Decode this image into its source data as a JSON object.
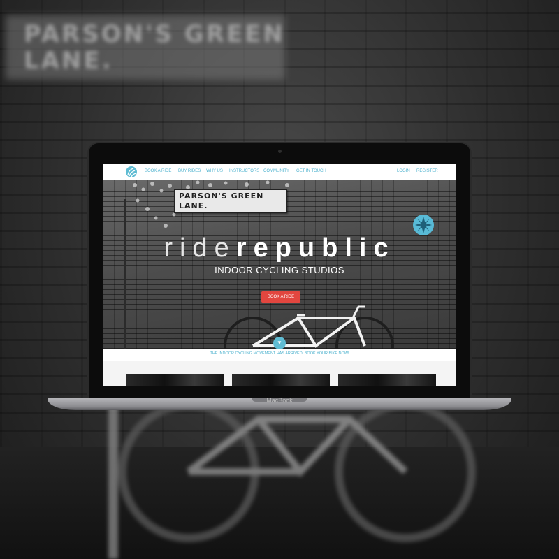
{
  "background": {
    "street_sign_text": "PARSON'S GREEN\nLANE."
  },
  "laptop": {
    "model_label": "MacBook"
  },
  "site": {
    "nav": {
      "logo_icon": "spiral-logo-icon",
      "links": [
        "BOOK A RIDE",
        "BUY RIDES",
        "WHY US",
        "INSTRUCTORS",
        "COMMUNITY",
        "GET IN TOUCH"
      ],
      "account_links": [
        "LOGIN",
        "REGISTER"
      ]
    },
    "hero": {
      "street_sign_line1": "PARSON'S GREEN",
      "street_sign_line2": "LANE.",
      "brand_light": "ride",
      "brand_bold": "republic",
      "subtitle": "INDOOR CYCLING STUDIOS",
      "cta_label": "BOOK A RIDE",
      "scroll_icon": "chevron-down-icon"
    },
    "announcement": "THE INDOOR CYCLING MOVEMENT HAS ARRIVED. BOOK YOUR BIKE NOW!",
    "colors": {
      "accent": "#4fb3cf",
      "cta": "#e2463f"
    }
  }
}
